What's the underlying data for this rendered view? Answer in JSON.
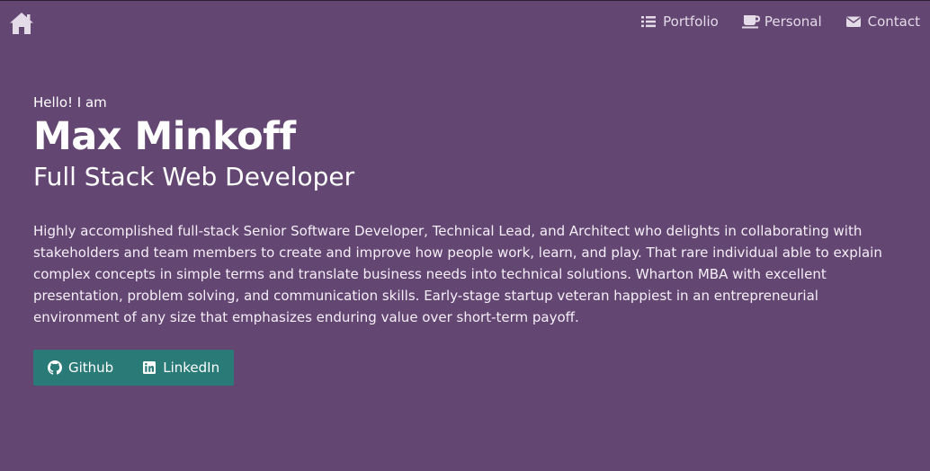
{
  "nav": {
    "home_icon": "home-icon",
    "links": [
      {
        "label": "Portfolio",
        "icon": "list-icon"
      },
      {
        "label": "Personal",
        "icon": "coffee-icon"
      },
      {
        "label": "Contact",
        "icon": "envelope-icon"
      }
    ]
  },
  "hero": {
    "greeting": "Hello! I am",
    "name": "Max Minkoff",
    "role": "Full Stack Web Developer",
    "bio": "Highly accomplished full-stack Senior Software Developer, Technical Lead, and Architect who delights in collaborating with stakeholders and team members to create and improve how people work, learn, and play. That rare individual able to explain complex concepts in simple terms and translate business needs into technical solutions. Wharton MBA with excellent presentation, problem solving, and communication skills. Early-stage startup veteran happiest in an entrepreneurial environment of any size that emphasizes enduring value over short-term payoff."
  },
  "buttons": {
    "github_label": "Github",
    "github_icon": "github-icon",
    "linkedin_label": "LinkedIn",
    "linkedin_icon": "linkedin-icon"
  },
  "colors": {
    "background": "#644673",
    "button_group": "#2a7a78",
    "nav_text": "#e3dbe7"
  }
}
